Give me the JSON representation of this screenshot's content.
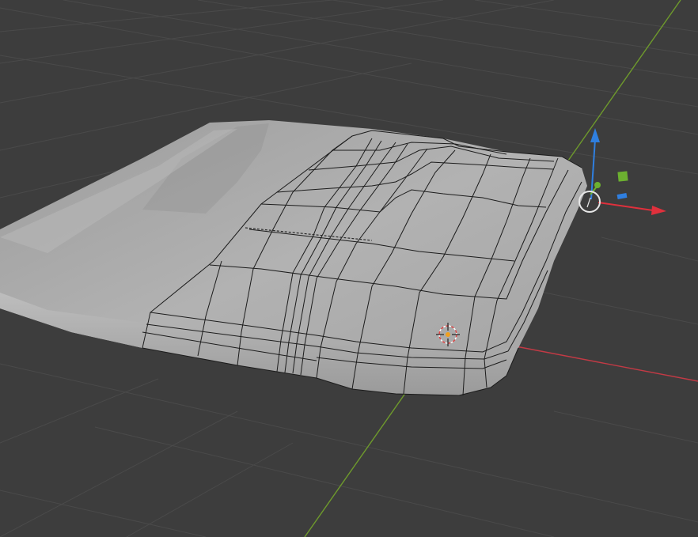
{
  "viewport": {
    "background": "#3d3d3d",
    "grid_color": "#4a4a4a",
    "axis_x_color": "#c23a45",
    "axis_y_color": "#6e9a2c",
    "mesh_color": "#a9a9a9",
    "wire_color": "#1c1c1c"
  },
  "gizmo": {
    "transform_icon": "move-gizmo-icon",
    "z_color": "#2f7fe0",
    "x_color": "#e0303c",
    "y_color": "#6cb030",
    "pivot_icon": "pivot-circle-icon",
    "plane_handle_yz_icon": "plane-handle-icon",
    "plane_handle_xy_icon": "plane-handle-icon"
  },
  "cursor": {
    "icon": "3d-cursor-icon",
    "color_outer": "#e04040",
    "color_inner": "#f0a020"
  }
}
